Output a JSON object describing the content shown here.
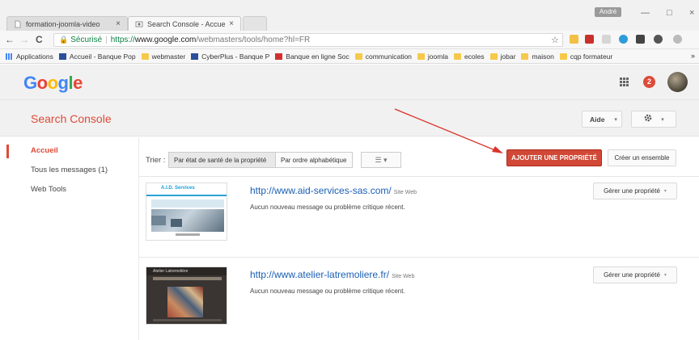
{
  "browser": {
    "tabs": [
      {
        "label": "formation-joomla-video",
        "close": "×"
      },
      {
        "label": "Search Console - Accueil",
        "close": "×"
      }
    ],
    "user_badge": "André",
    "window_controls": {
      "minimize": "—",
      "maximize": "□",
      "close": "×"
    },
    "nav": {
      "back": "←",
      "forward": "→",
      "reload": "C"
    },
    "address": {
      "secure_label": "Sécurisé",
      "url_scheme": "https://",
      "url_host": "www.google.com",
      "url_path": "/webmasters/tools/home?hl=FR",
      "star": "☆"
    },
    "bookmarks": [
      {
        "label": "Applications",
        "icon": "apps-grid-icon"
      },
      {
        "label": "Accueil - Banque Pop",
        "icon": "bank-icon"
      },
      {
        "label": "webmaster",
        "icon": "folder-icon"
      },
      {
        "label": "CyberPlus - Banque P",
        "icon": "bank-icon"
      },
      {
        "label": "Banque en ligne Soc",
        "icon": "bank-icon"
      },
      {
        "label": "communication",
        "icon": "folder-icon"
      },
      {
        "label": "joomla",
        "icon": "folder-icon"
      },
      {
        "label": "ecoles",
        "icon": "folder-icon"
      },
      {
        "label": "jobar",
        "icon": "folder-icon"
      },
      {
        "label": "maison",
        "icon": "folder-icon"
      },
      {
        "label": "cqp formateur",
        "icon": "folder-icon"
      }
    ],
    "bookmarks_more": "»"
  },
  "google_bar": {
    "logo_letters": [
      "G",
      "o",
      "o",
      "g",
      "l",
      "e"
    ],
    "logo_colors": [
      "#4285f4",
      "#ea4335",
      "#fbbc05",
      "#4285f4",
      "#34a853",
      "#ea4335"
    ],
    "notifications_count": "2"
  },
  "header": {
    "title": "Search Console",
    "help_label": "Aide",
    "caret": "▾",
    "gear": "✿"
  },
  "sidebar": {
    "items": [
      {
        "label": "Accueil",
        "active": true
      },
      {
        "label": "Tous les messages (1)",
        "active": false
      },
      {
        "label": "Web Tools",
        "active": false
      }
    ]
  },
  "toolbar": {
    "sort_label": "Trier :",
    "sort_health": "Par état de santé de la propriété",
    "sort_alpha": "Par ordre alphabétique",
    "view_icon": "☰ ▾",
    "add_property": "AJOUTER UNE PROPRIÉTÉ",
    "create_set": "Créer un ensemble"
  },
  "sites": [
    {
      "url": "http://www.aid-services-sas.com/",
      "type": "Site Web",
      "message": "Aucun nouveau message ou problème critique récent.",
      "manage_label": "Gérer une propriété",
      "thumb_title": "A.I.D. Services"
    },
    {
      "url": "http://www.atelier-latremoliere.fr/",
      "type": "Site Web",
      "message": "Aucun nouveau message ou problème critique récent.",
      "manage_label": "Gérer une propriété",
      "thumb_title": "Atelier Latremolière"
    }
  ],
  "colors": {
    "accent_red": "#dd4b39",
    "button_red": "#d14836",
    "link_blue": "#1a5fb4",
    "arrow_red": "#d9342b"
  }
}
